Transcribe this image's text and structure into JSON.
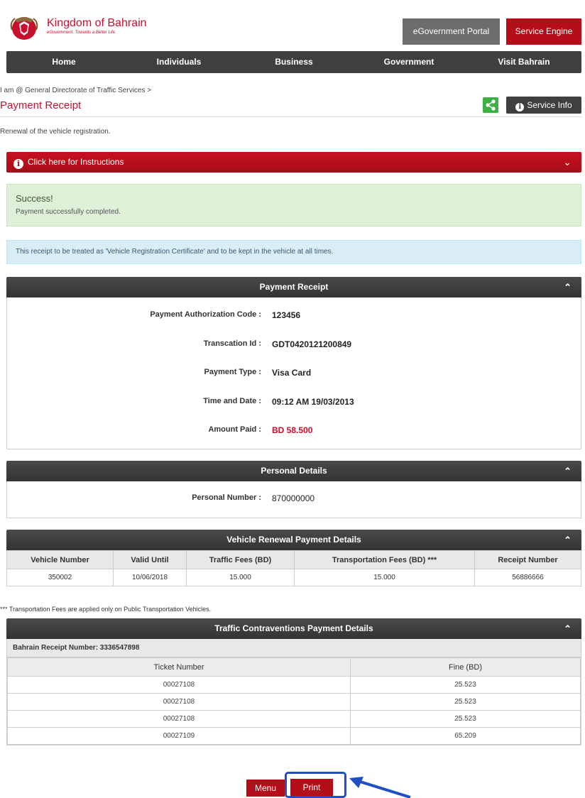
{
  "header": {
    "logo_title": "Kingdom of Bahrain",
    "logo_tagline": "eGovernment. Towards a Better Life",
    "portal_button": "eGovernment Portal",
    "engine_button": "Service Engine"
  },
  "nav": {
    "items": [
      "Home",
      "Individuals",
      "Business",
      "Government",
      "Visit Bahrain"
    ]
  },
  "breadcrumb": "I am @ General Directorate of Traffic Services >",
  "page_title": "Payment Receipt",
  "service_info": "Service Info",
  "description": "Renewal of the vehicle registration.",
  "instructions": "Click here for Instructions",
  "success": {
    "title": "Success!",
    "message": "Payment successfully completed."
  },
  "info_note": "This receipt to be treated as 'Vehicle Registration Certificate' and to be kept in the vehicle at all times.",
  "payment_receipt": {
    "heading": "Payment Receipt",
    "rows": [
      {
        "label": "Payment Authorization Code :",
        "value": "123456"
      },
      {
        "label": "Transcation Id :",
        "value": "GDT0420121200849"
      },
      {
        "label": "Payment Type :",
        "value": "Visa Card"
      },
      {
        "label": "Time and Date :",
        "value": "09:12 AM 19/03/2013"
      },
      {
        "label": "Amount Paid :",
        "value": "BD 58.500"
      }
    ]
  },
  "personal_details": {
    "heading": "Personal Details",
    "label": "Personal Number :",
    "value": "870000000"
  },
  "vehicle_renewal": {
    "heading": "Vehicle Renewal Payment Details",
    "columns": [
      "Vehicle Number",
      "Valid Until",
      "Traffic Fees (BD)",
      "Transportation Fees (BD) ***",
      "Receipt Number"
    ],
    "row": [
      "350002",
      "10/06/2018",
      "15.000",
      "15.000",
      "56886666"
    ]
  },
  "transport_note": "*** Transportation Fees are applied only on Public Transportation Vehicles.",
  "contraventions": {
    "heading": "Traffic Contraventions Payment Details",
    "receipt_number": "Bahrain Receipt Number: 3336547898",
    "columns": [
      "Ticket Number",
      "Fine (BD)"
    ],
    "rows": [
      [
        "00027108",
        "25.523"
      ],
      [
        "00027108",
        "25.523"
      ],
      [
        "00027108",
        "25.523"
      ],
      [
        "00027109",
        "65.209"
      ]
    ]
  },
  "buttons": {
    "menu": "Menu",
    "print": "Print"
  },
  "colors": {
    "brand_red": "#b50e1b",
    "dark_bar": "#3f3f3f",
    "annotation_blue": "#1f4fc4"
  }
}
